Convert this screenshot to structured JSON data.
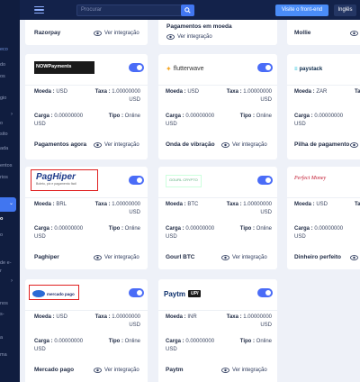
{
  "colors": {
    "accent": "#4176f0",
    "toggle_on": "#4a6cf7",
    "sidebar_bg": "#101d3f",
    "topbar_bg": "#13224a",
    "highlight": "#e02020"
  },
  "topbar": {
    "search_placeholder": "Procurar",
    "front_button": "Visite o front-end",
    "language": "Inglês"
  },
  "sidebar": {
    "items": [
      "eco",
      "do",
      "os",
      "gio",
      "o",
      "sito",
      "ada",
      "entos",
      "rios",
      "o",
      "o",
      "de e-",
      "r",
      "nos",
      "s-",
      "a",
      "ma"
    ]
  },
  "common": {
    "view_integration": "Ver integração",
    "currency_label": "Moeda :",
    "rate_label": "Taxa :",
    "charge_label": "Carga :",
    "type_label": "Tipo :"
  },
  "top_partial": [
    {
      "name": "Razorpay"
    },
    {
      "name": "Pagamentos em moeda"
    },
    {
      "name": "Mollie"
    }
  ],
  "cards": [
    {
      "logo": "NOWPayments",
      "currency": "USD",
      "rate": "1.00000000",
      "rate_unit": "USD",
      "charge": "0.00000000",
      "charge_unit": "USD",
      "type": "Online",
      "name": "Pagamentos agora"
    },
    {
      "logo": "flutterwave",
      "currency": "USD",
      "rate": "1.00000000",
      "rate_unit": "USD",
      "charge": "0.00000000",
      "charge_unit": "USD",
      "type": "Online",
      "name": "Onda de vibração"
    },
    {
      "logo": "paystack",
      "currency": "ZAR",
      "rate": "",
      "rate_unit": "",
      "charge": "0.00000000",
      "charge_unit": "USD",
      "type": "",
      "name": "Pilha de pagamento"
    },
    {
      "logo": "PagHiper",
      "logo_sub": "Boleto, pix e pagamento fácil",
      "currency": "BRL",
      "rate": "1.00000000",
      "rate_unit": "USD",
      "charge": "0.00000000",
      "charge_unit": "USD",
      "type": "Online",
      "name": "Paghiper"
    },
    {
      "logo": "GOURL CRYPTO",
      "currency": "BTC",
      "rate": "1.00000000",
      "rate_unit": "USD",
      "charge": "0.00000000",
      "charge_unit": "USD",
      "type": "Online",
      "name": "Gourl BTC"
    },
    {
      "logo": "Perfect Money",
      "currency": "USD",
      "rate": "",
      "rate_unit": "",
      "charge": "0.00000000",
      "charge_unit": "USD",
      "type": "",
      "name": "Dinheiro perfeito"
    },
    {
      "logo": "mercado pago",
      "currency": "USD",
      "rate": "1.00000000",
      "rate_unit": "USD",
      "charge": "0.00000000",
      "charge_unit": "USD",
      "type": "Online",
      "name": "Mercado pago"
    },
    {
      "logo": "Paytm",
      "logo_upi": "UPI",
      "currency": "INR",
      "rate": "1.00000000",
      "rate_unit": "USD",
      "charge": "0.00000000",
      "charge_unit": "USD",
      "type": "Online",
      "name": "Paytm"
    }
  ]
}
